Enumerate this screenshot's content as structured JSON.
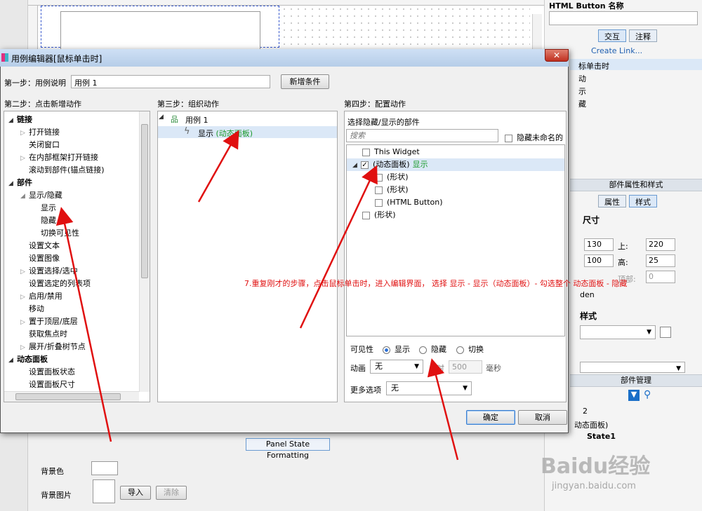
{
  "right_panel": {
    "title": "HTML Button  名称",
    "tabs": [
      "交互",
      "注释"
    ],
    "create_link": "Create Link...",
    "event_partial": "标单击时",
    "cut_items": [
      "动",
      "示",
      "藏"
    ],
    "props_header": "部件属性和样式",
    "props_tabs": [
      "属性",
      "样式"
    ],
    "size_label": "尺寸",
    "fields": {
      "x": "130",
      "top_label": "上:",
      "top": "220",
      "w": "100",
      "h_label": "高:",
      "h": "25",
      "right_cut": "顶部:",
      "right_cut_val": "0"
    },
    "hidden_cut": "den",
    "style_cut": "样式",
    "manager_header": "部件管理",
    "manager_items": [
      "2",
      "动态面板)",
      "State1"
    ]
  },
  "dialog": {
    "title": "用例编辑器[鼠标单击时]",
    "close": "✕",
    "step1_label": "第一步：用例说明",
    "step1_value": "用例 1",
    "add_condition": "新增条件",
    "step2_label": "第二步：点击新增动作",
    "step3_label": "第三步：组织动作",
    "step4_label": "第四步：配置动作",
    "tree": [
      {
        "text": "链接",
        "bold": true,
        "level": 0,
        "exp": "◢"
      },
      {
        "text": "打开链接",
        "level": 1,
        "exp": "▷"
      },
      {
        "text": "关闭窗口",
        "level": 1,
        "exp": ""
      },
      {
        "text": "在内部框架打开链接",
        "level": 1,
        "exp": "▷"
      },
      {
        "text": "滚动到部件(锚点链接)",
        "level": 1,
        "exp": ""
      },
      {
        "text": "部件",
        "bold": true,
        "level": 0,
        "exp": "◢"
      },
      {
        "text": "显示/隐藏",
        "level": 1,
        "exp": "◢"
      },
      {
        "text": "显示",
        "level": 2,
        "exp": ""
      },
      {
        "text": "隐藏",
        "level": 2,
        "exp": ""
      },
      {
        "text": "切换可见性",
        "level": 2,
        "exp": ""
      },
      {
        "text": "设置文本",
        "level": 1,
        "exp": ""
      },
      {
        "text": "设置图像",
        "level": 1,
        "exp": ""
      },
      {
        "text": "设置选择/选中",
        "level": 1,
        "exp": "▷"
      },
      {
        "text": "设置选定的列表项",
        "level": 1,
        "exp": ""
      },
      {
        "text": "启用/禁用",
        "level": 1,
        "exp": "▷"
      },
      {
        "text": "移动",
        "level": 1,
        "exp": ""
      },
      {
        "text": "置于顶层/底层",
        "level": 1,
        "exp": "▷"
      },
      {
        "text": "获取焦点时",
        "level": 1,
        "exp": ""
      },
      {
        "text": "展开/折叠树节点",
        "level": 1,
        "exp": "▷"
      },
      {
        "text": "动态面板",
        "bold": true,
        "level": 0,
        "exp": "◢"
      },
      {
        "text": "设置面板状态",
        "level": 1,
        "exp": ""
      },
      {
        "text": "设置面板尺寸",
        "level": 1,
        "exp": ""
      }
    ],
    "case_name": "用例 1",
    "action_name": "显示",
    "action_target": "(动态面板)",
    "choose_label": "选择隐藏/显示的部件",
    "search_placeholder": "搜索",
    "hide_unnamed": "隐藏未命名的",
    "widgets": [
      {
        "text": "This Widget",
        "checked": false,
        "indent": 0,
        "extra": ""
      },
      {
        "text": "(动态面板)",
        "checked": true,
        "indent": 0,
        "extra": "显示",
        "selected": true
      },
      {
        "text": "(形状)",
        "checked": false,
        "indent": 1,
        "extra": ""
      },
      {
        "text": "(形状)",
        "checked": false,
        "indent": 1,
        "extra": ""
      },
      {
        "text": "(HTML Button)",
        "checked": false,
        "indent": 1,
        "extra": ""
      },
      {
        "text": "(形状)",
        "checked": false,
        "indent": 0,
        "extra": ""
      }
    ],
    "visibility_label": "可见性",
    "vis_options": [
      "显示",
      "隐藏",
      "切换"
    ],
    "anim_label": "动画",
    "anim_value": "无",
    "duration_label": "用时",
    "duration_value": "500",
    "ms_label": "毫秒",
    "more_label": "更多选项",
    "more_value": "无",
    "ok": "确定",
    "cancel": "取消"
  },
  "bottom": {
    "tab": "Panel State Formatting",
    "bg_color": "背景色",
    "bg_image": "背景图片",
    "import": "导入",
    "clear": "清除"
  },
  "annotation": "7.重复刚才的步骤，点击鼠标单击时，进入编辑界面，  选择 显示 - 显示（动态面板）- 勾选整个 动态面板 - 隐藏",
  "watermark": {
    "logo": "Baidu经验",
    "url": "jingyan.baidu.com"
  }
}
